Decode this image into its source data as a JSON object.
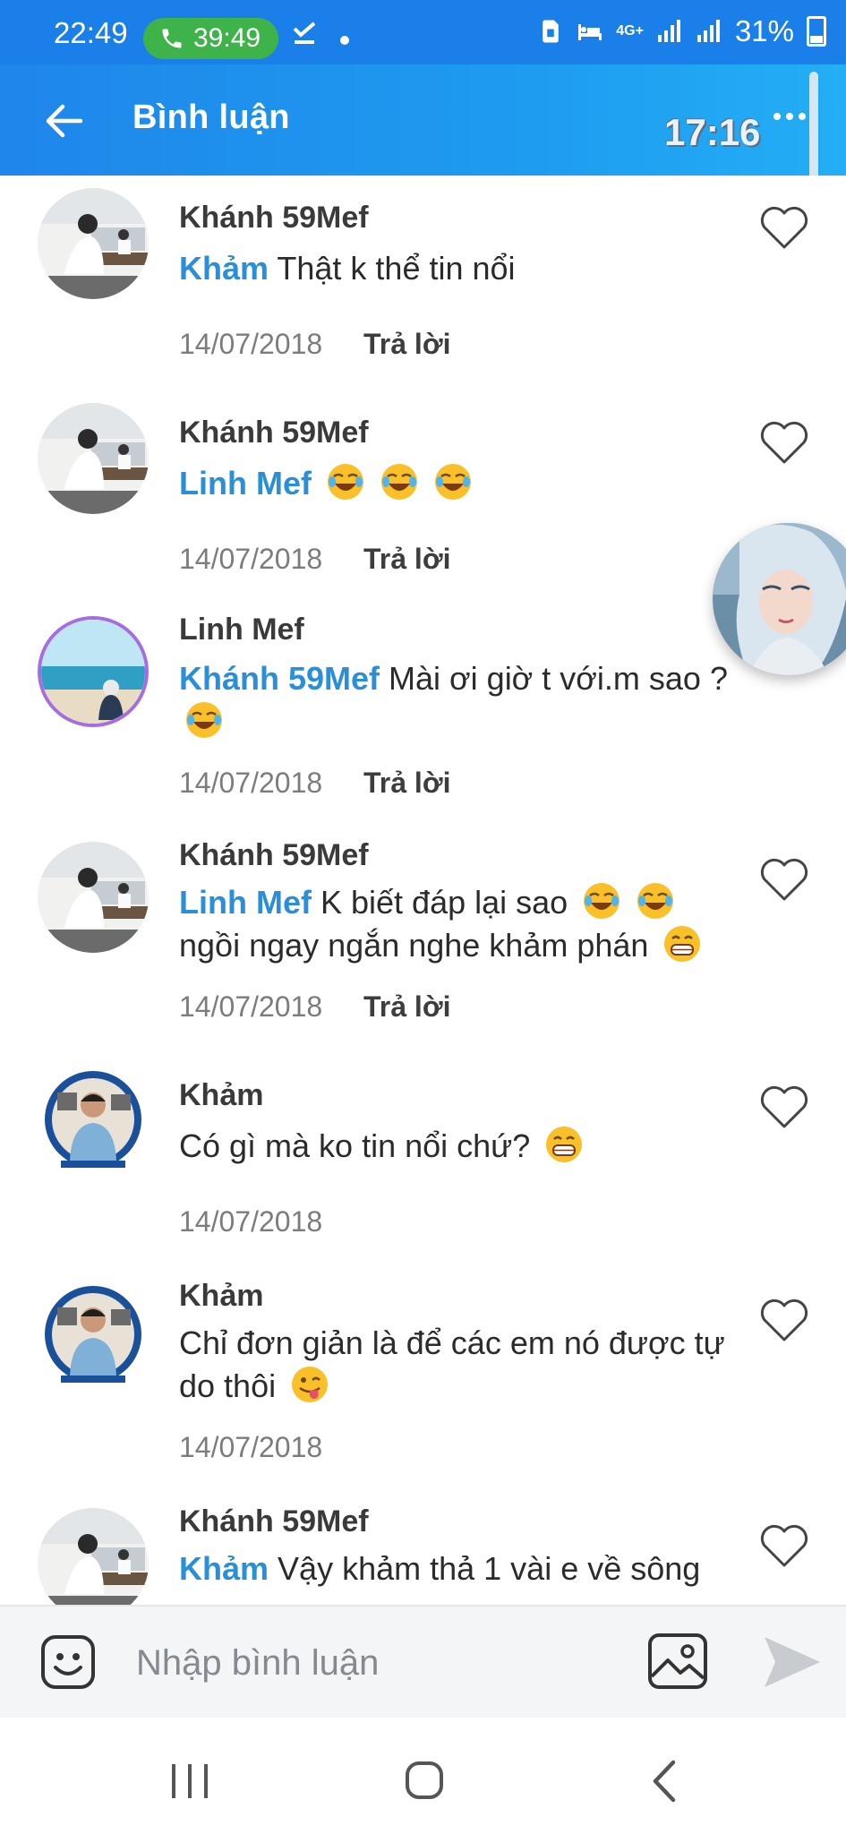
{
  "status_bar": {
    "time": "22:49",
    "call_timer": "39:49",
    "network": "4G+",
    "battery": "31%"
  },
  "app_bar": {
    "title": "Bình luận",
    "timer_overlay": "17:16"
  },
  "comments": [
    {
      "author": "Khánh 59Mef",
      "mention": "Khảm",
      "text": " Thật k thể tin nổi",
      "emojis": [],
      "date": "14/07/2018",
      "reply": "Trả lời",
      "avatar": "office-photo"
    },
    {
      "author": "Khánh 59Mef",
      "mention": "Linh Mef",
      "text": "",
      "emojis": [
        "laugh",
        "laugh",
        "laugh"
      ],
      "date": "14/07/2018",
      "reply": "Trả lời",
      "avatar": "office-photo"
    },
    {
      "author": "Linh Mef",
      "mention": "Khánh 59Mef",
      "text": " Mài ơi giờ t với.m sao ?",
      "emojis": [
        "laugh"
      ],
      "date": "14/07/2018",
      "reply": "Trả lời",
      "avatar": "beach-photo"
    },
    {
      "author": "Khánh 59Mef",
      "mention": "Linh Mef",
      "text": " K biết đáp lại sao",
      "text2": "ngồi ngay ngắn nghe khảm phán",
      "emojis": [
        "laugh",
        "laugh"
      ],
      "emojis2": [
        "grin"
      ],
      "date": "14/07/2018",
      "reply": "Trả lời",
      "avatar": "office-photo"
    },
    {
      "author": "Khảm",
      "mention": "",
      "text": "Có gì mà ko tin nổi chứ?",
      "emojis": [
        "grin"
      ],
      "date": "14/07/2018",
      "reply": "",
      "avatar": "bkapema-photo"
    },
    {
      "author": "Khảm",
      "mention": "",
      "text": "Chỉ đơn giản là để các em nó được tự do thôi",
      "emojis": [
        "wink-tongue"
      ],
      "date": "14/07/2018",
      "reply": "",
      "avatar": "bkapema-photo"
    },
    {
      "author": "Khánh 59Mef",
      "mention": "Khảm",
      "text": " Vậy khảm thả 1 vài e về sông",
      "emojis": [],
      "date": "",
      "reply": "",
      "avatar": "office-photo"
    }
  ],
  "composer": {
    "placeholder": "Nhập bình luận"
  },
  "colors": {
    "app_bar": "#1f86ea",
    "mention": "#2a8fd6",
    "call_pill": "#3db34a"
  }
}
